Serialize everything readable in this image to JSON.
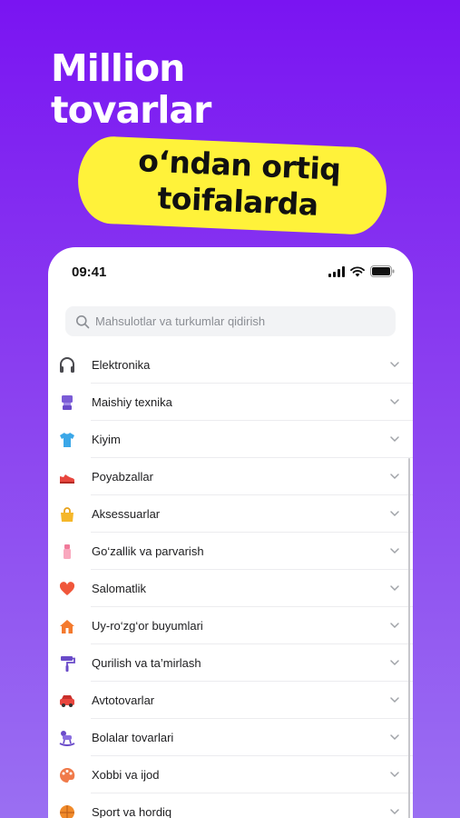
{
  "hero": {
    "title_line1": "Million",
    "title_line2": "tovarlar",
    "sticker_line1": "o‘ndan ortiq",
    "sticker_line2": "toifalarda"
  },
  "status_bar": {
    "time": "09:41"
  },
  "search": {
    "placeholder": "Mahsulotlar va turkumlar qidirish"
  },
  "categories": [
    {
      "label": "Elektronika",
      "icon": "headphones-icon"
    },
    {
      "label": "Maishiy texnika",
      "icon": "appliance-icon"
    },
    {
      "label": "Kiyim",
      "icon": "tshirt-icon"
    },
    {
      "label": "Poyabzallar",
      "icon": "sneaker-icon"
    },
    {
      "label": "Aksessuarlar",
      "icon": "handbag-icon"
    },
    {
      "label": "Go‘zallik va parvarish",
      "icon": "cosmetics-icon"
    },
    {
      "label": "Salomatlik",
      "icon": "heart-icon"
    },
    {
      "label": "Uy-ro‘zg‘or buyumlari",
      "icon": "house-icon"
    },
    {
      "label": "Qurilish va ta’mirlash",
      "icon": "paint-roller-icon"
    },
    {
      "label": "Avtotovarlar",
      "icon": "car-icon"
    },
    {
      "label": "Bolalar tovarlari",
      "icon": "rocking-horse-icon"
    },
    {
      "label": "Xobbi va ijod",
      "icon": "palette-icon"
    },
    {
      "label": "Sport va hordiq",
      "icon": "ball-icon"
    }
  ],
  "colors": {
    "background_top": "#7a14f2",
    "background_bottom": "#9a6ff2",
    "sticker": "#fff23a"
  }
}
